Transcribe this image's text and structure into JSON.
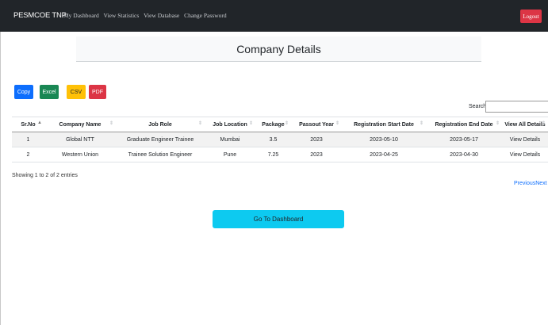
{
  "navbar": {
    "brand": "PESMCOE TNP",
    "links": [
      "My Dashboard",
      "View Statistics",
      "View Database",
      "Change Password"
    ],
    "logout": "Logout"
  },
  "page_title": "Company Details",
  "export_buttons": [
    "Copy",
    "Excel",
    "CSV",
    "PDF"
  ],
  "search": {
    "label": "Search:",
    "value": ""
  },
  "table": {
    "columns": [
      "Sr.No",
      "Company Name",
      "Job Role",
      "Job Location",
      "Package",
      "Passout Year",
      "Registration Start Date",
      "Registration End Date",
      "View All Details"
    ],
    "sorted_column": "Sr.No",
    "rows": [
      [
        "1",
        "Global NTT",
        "Graduate Engineer Trainee",
        "Mumbai",
        "3.5",
        "2023",
        "2023-05-10",
        "2023-05-17",
        "View Details"
      ],
      [
        "2",
        "Western Union",
        "Trainee Solution Engineer",
        "Pune",
        "7.25",
        "2023",
        "2023-04-25",
        "2023-04-30",
        "View Details"
      ]
    ]
  },
  "info_text": "Showing 1 to 2 of 2 entries",
  "pagination": {
    "previous": "Previous",
    "next": "Next"
  },
  "dashboard_button": "Go To Dashboard",
  "colors": {
    "navbar_bg": "#212529",
    "logout": "#dc3545",
    "copy": "#0d6efd",
    "excel": "#198754",
    "csv": "#ffc107",
    "pdf": "#dc3545",
    "dashboard_button": "#0dcaf0"
  }
}
